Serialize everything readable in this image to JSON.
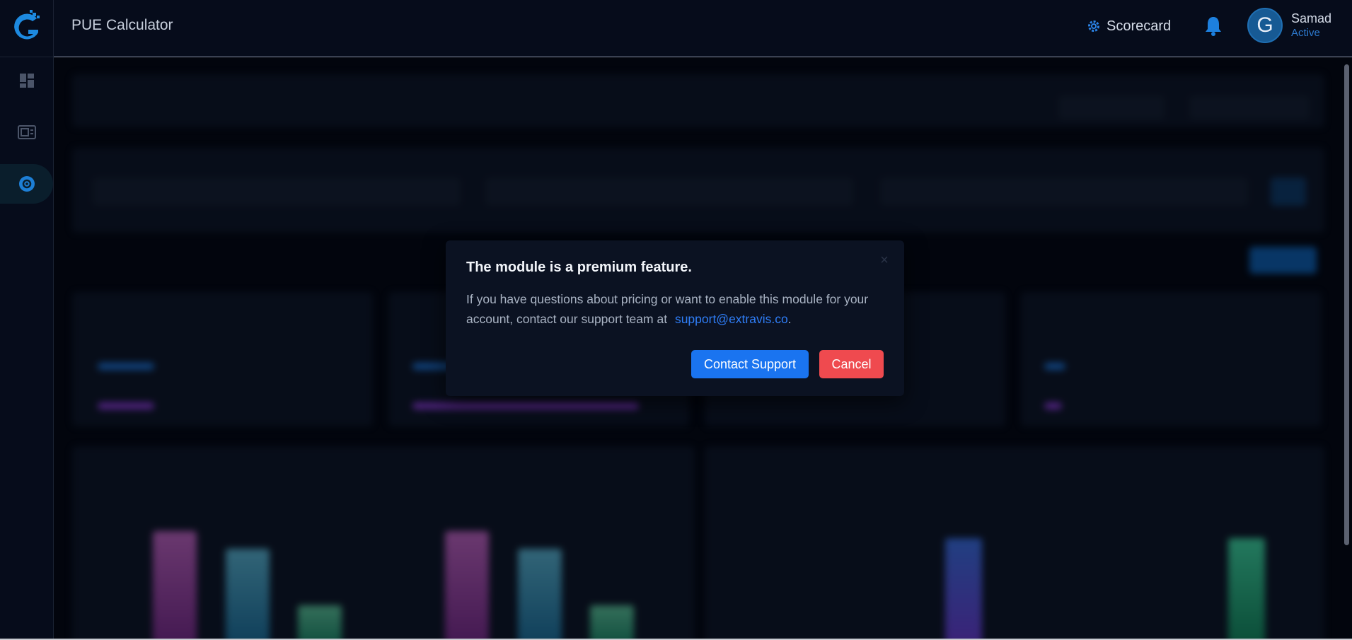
{
  "header": {
    "app_title": "PUE Calculator",
    "scorecard_label": "Scorecard",
    "user": {
      "initial": "G",
      "name": "Samad",
      "status": "Active"
    }
  },
  "sidebar": {
    "items": [
      {
        "icon": "dashboard-icon"
      },
      {
        "icon": "reports-icon"
      },
      {
        "icon": "pue-calculator-icon",
        "active": true
      }
    ]
  },
  "modal": {
    "title": "The module is a premium feature.",
    "body_text": "If you have questions about pricing or want to enable this module for your account, contact our support team at",
    "link_text": "support@extravis.co",
    "link_suffix": ".",
    "close_glyph": "×",
    "primary_button": "Contact Support",
    "cancel_button": "Cancel"
  },
  "colors": {
    "background": "#040915",
    "accent_blue": "#1a74f0",
    "danger_red": "#ef4a4f",
    "status_blue": "#2d7bd1"
  }
}
